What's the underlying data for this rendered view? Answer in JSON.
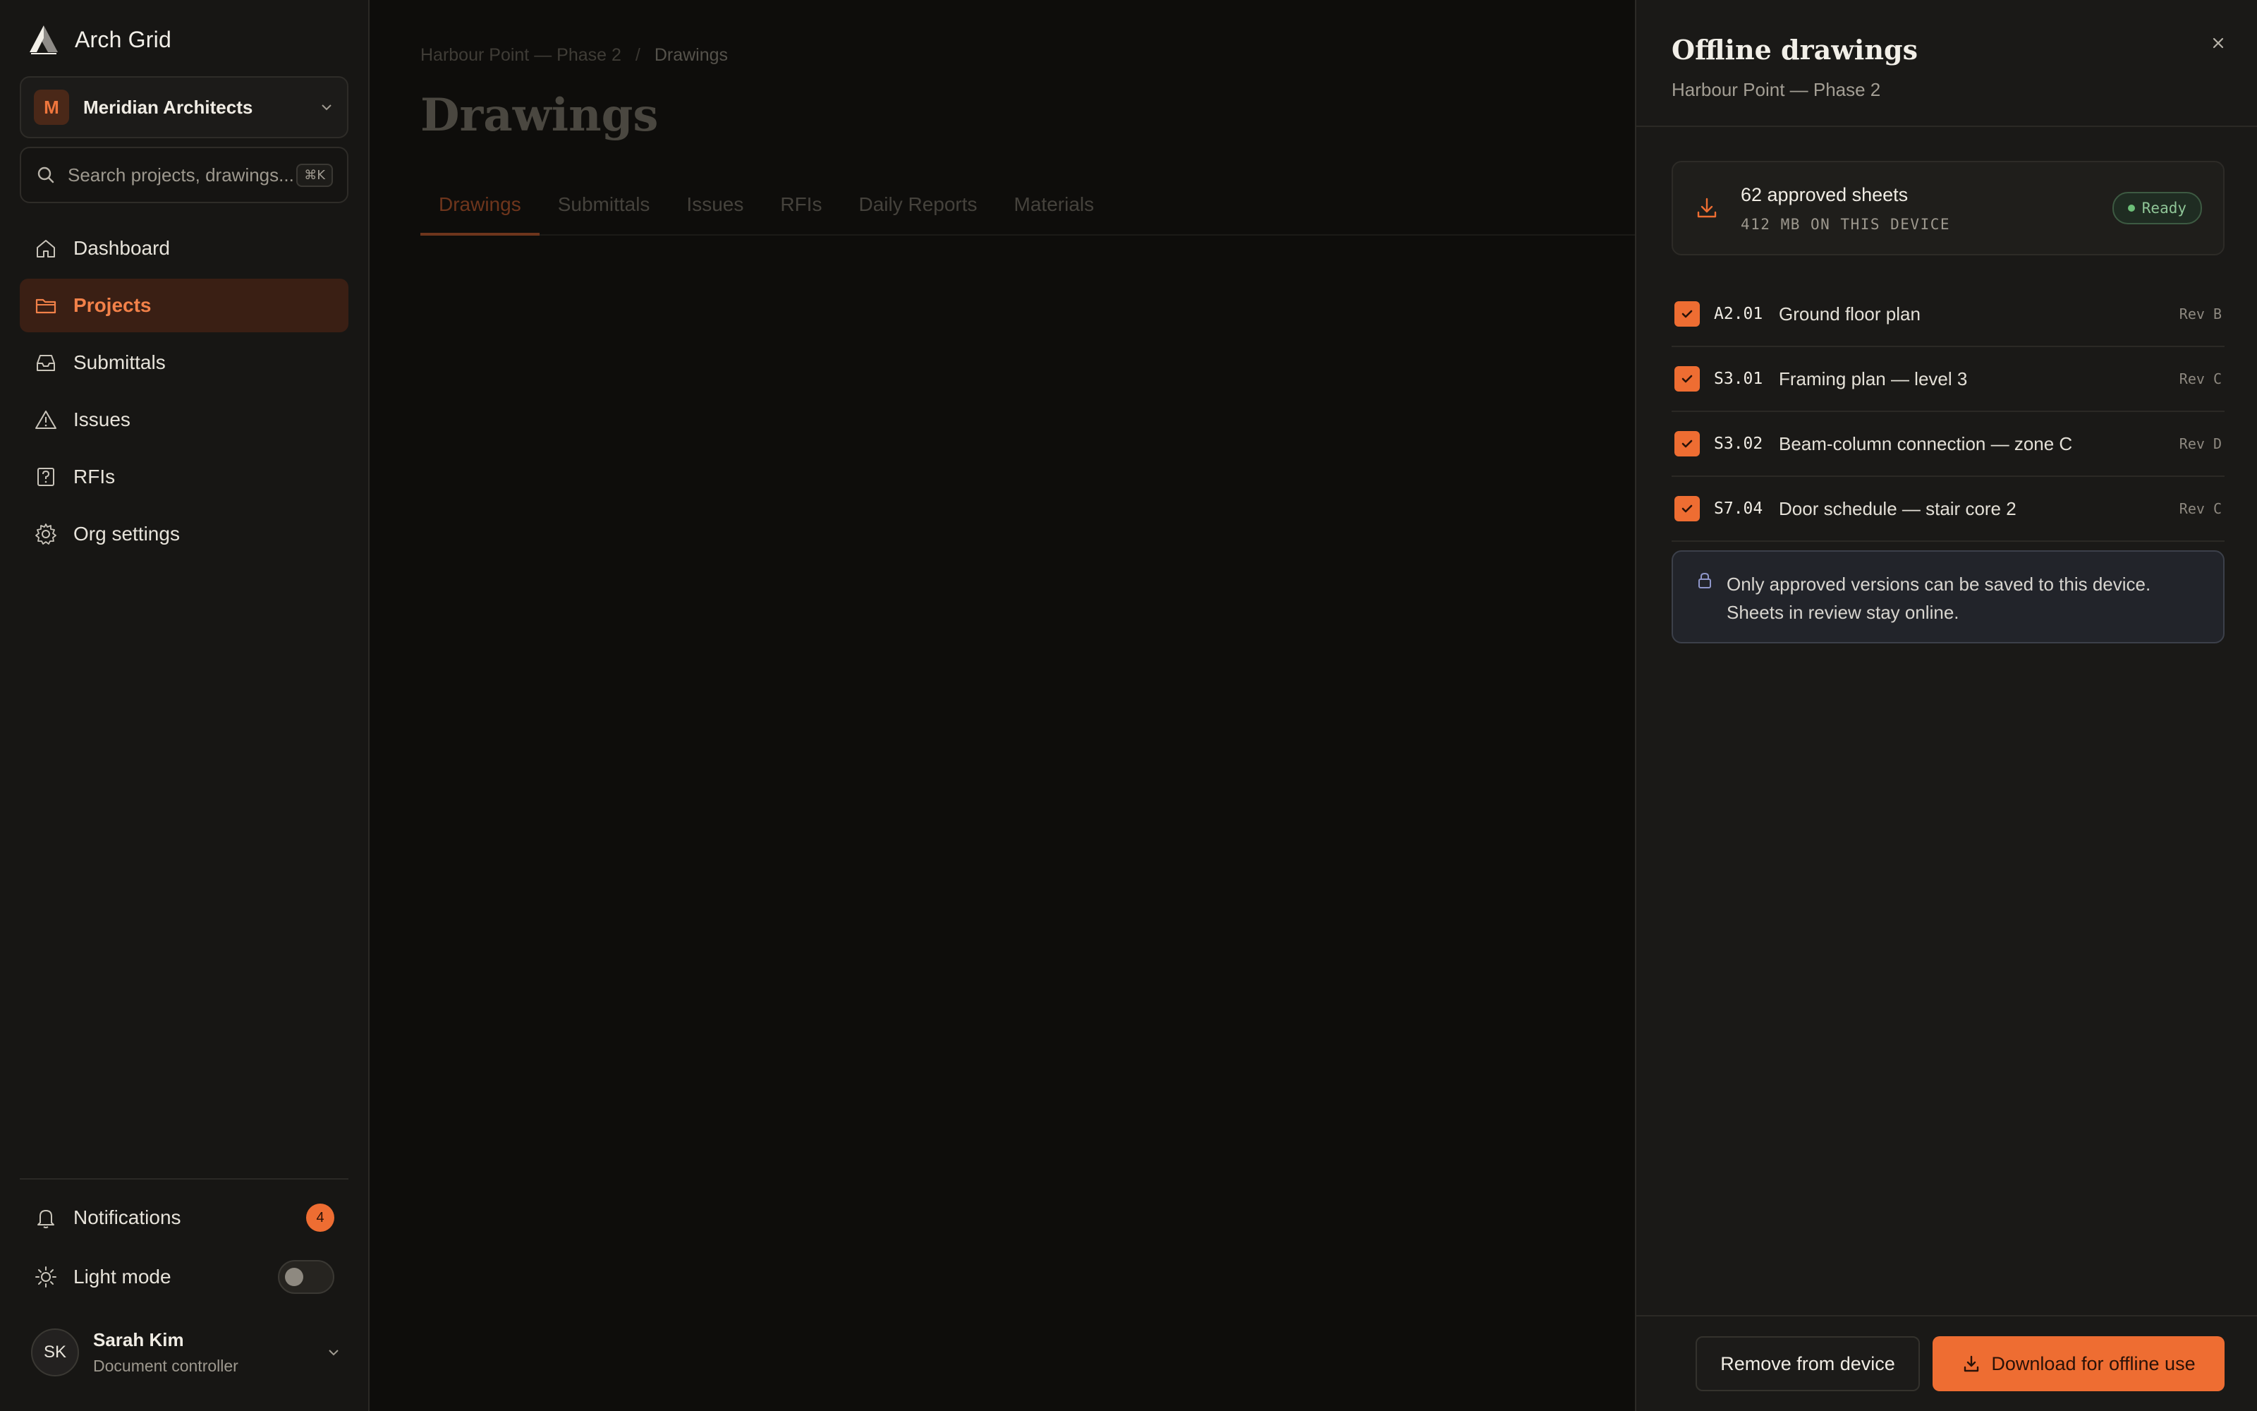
{
  "app": {
    "name": "Arch Grid"
  },
  "org": {
    "name": "Meridian Architects",
    "initial": "M"
  },
  "search": {
    "placeholder": "Search projects, drawings...",
    "shortcut": "⌘K"
  },
  "nav": [
    {
      "label": "Dashboard",
      "icon": "home-icon"
    },
    {
      "label": "Projects",
      "icon": "folder-icon",
      "active": true
    },
    {
      "label": "Submittals",
      "icon": "inbox-icon"
    },
    {
      "label": "Issues",
      "icon": "warning-icon"
    },
    {
      "label": "RFIs",
      "icon": "question-icon"
    },
    {
      "label": "Org settings",
      "icon": "gear-icon"
    }
  ],
  "utilities": {
    "notifications": {
      "label": "Notifications",
      "count": "4"
    },
    "light_mode": {
      "label": "Light mode",
      "enabled": false
    }
  },
  "user": {
    "initials": "SK",
    "name": "Sarah Kim",
    "role": "Document controller"
  },
  "main": {
    "breadcrumb": [
      "Harbour Point — Phase 2",
      "Drawings"
    ],
    "breadcrumb_separator": "/",
    "title": "Drawings",
    "tabs": [
      "Drawings",
      "Submittals",
      "Issues",
      "RFIs",
      "Daily Reports",
      "Materials"
    ],
    "active_tab": "Drawings"
  },
  "drawer": {
    "title": "Offline drawings",
    "subtitle": "Harbour Point — Phase 2",
    "summary": {
      "title": "62 approved sheets",
      "size": "412 MB ON THIS DEVICE",
      "status": "Ready"
    },
    "sheets": [
      {
        "code": "A2.01",
        "name": "Ground floor plan",
        "rev": "Rev B",
        "checked": true
      },
      {
        "code": "S3.01",
        "name": "Framing plan — level 3",
        "rev": "Rev C",
        "checked": true
      },
      {
        "code": "S3.02",
        "name": "Beam-column connection — zone C",
        "rev": "Rev D",
        "checked": true
      },
      {
        "code": "S7.04",
        "name": "Door schedule — stair core 2",
        "rev": "Rev C",
        "checked": true
      }
    ],
    "notice": "Only approved versions can be saved to this device. Sheets in review stay online.",
    "remove_label": "Remove from device",
    "download_label": "Download for offline use"
  },
  "colors": {
    "accent": "#ee6d32",
    "ready": "#6cbf78",
    "background": "#0e0d0b",
    "panel": "#1a1917"
  }
}
